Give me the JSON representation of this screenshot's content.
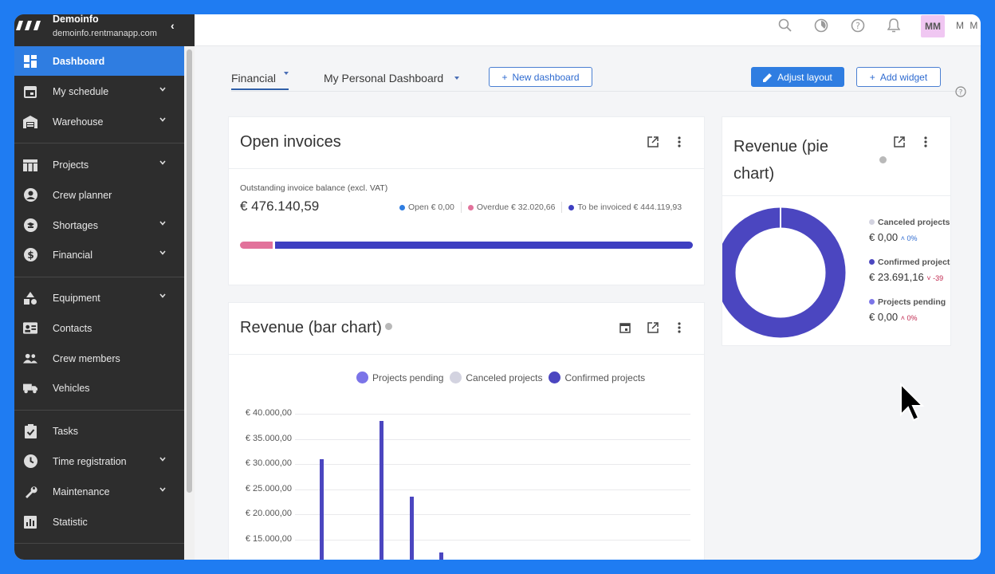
{
  "sidebar": {
    "company": "Demoinfo",
    "url": "demoinfo.rentmanapp.com",
    "items": [
      {
        "label": "Dashboard",
        "icon": "dashboard-icon"
      },
      {
        "label": "My schedule",
        "icon": "calendar-icon"
      },
      {
        "label": "Warehouse",
        "icon": "warehouse-icon"
      },
      {
        "label": "Projects",
        "icon": "projects-icon"
      },
      {
        "label": "Crew planner",
        "icon": "person-icon"
      },
      {
        "label": "Shortages",
        "icon": "shortages-icon"
      },
      {
        "label": "Financial",
        "icon": "dollar-icon"
      },
      {
        "label": "Equipment",
        "icon": "shapes-icon"
      },
      {
        "label": "Contacts",
        "icon": "contact-card-icon"
      },
      {
        "label": "Crew members",
        "icon": "group-icon"
      },
      {
        "label": "Vehicles",
        "icon": "truck-icon"
      },
      {
        "label": "Tasks",
        "icon": "clipboard-check-icon"
      },
      {
        "label": "Time registration",
        "icon": "clock-icon"
      },
      {
        "label": "Maintenance",
        "icon": "wrench-icon"
      },
      {
        "label": "Statistic",
        "icon": "bar-chart-icon"
      }
    ]
  },
  "topbar": {
    "avatar_initials": "MM",
    "username": "M M"
  },
  "tabs": {
    "financial": "Financial",
    "personal": "My Personal Dashboard",
    "new_dashboard": "New dashboard",
    "adjust_layout": "Adjust layout",
    "add_widget": "Add widget"
  },
  "open_invoices": {
    "title": "Open invoices",
    "subtitle": "Outstanding invoice balance (excl. VAT)",
    "total": "€ 476.140,59",
    "legend": [
      {
        "label": "Open",
        "value": "€ 0,00",
        "color": "#2f7de1"
      },
      {
        "label": "Overdue",
        "value": "€ 32.020,66",
        "color": "#e2729b"
      },
      {
        "label": "To be invoiced",
        "value": "€ 444.119,93",
        "color": "#3e3fc1"
      }
    ],
    "progress": {
      "overdue_fraction": 0.073,
      "to_be_invoiced_fraction": 0.927
    }
  },
  "revenue_pie": {
    "title_line1": "Revenue (pie",
    "title_line2": "chart)",
    "legend": [
      {
        "label": "Canceled projects",
        "value": "€ 0,00",
        "change": "0%",
        "color": "#d3d3e0"
      },
      {
        "label": "Confirmed projects",
        "value": "€ 23.691,16",
        "change": "-39",
        "color": "#4b46c0"
      },
      {
        "label": "Projects pending",
        "value": "€ 0,00",
        "change": "0%",
        "color": "#7b74e8"
      }
    ]
  },
  "revenue_bar": {
    "title": "Revenue (bar chart)",
    "legend": [
      {
        "label": "Projects pending",
        "color": "#7b74e8"
      },
      {
        "label": "Canceled projects",
        "color": "#d3d3e0"
      },
      {
        "label": "Confirmed projects",
        "color": "#4b46c0"
      }
    ]
  },
  "chart_data": [
    {
      "type": "pie",
      "title": "Revenue (pie chart)",
      "labels": [
        "Canceled projects",
        "Confirmed projects",
        "Projects pending"
      ],
      "values": [
        0,
        23691.16,
        0
      ]
    },
    {
      "type": "bar",
      "title": "Revenue (bar chart)",
      "series": [
        {
          "name": "Confirmed projects",
          "values": [
            31000,
            38500,
            23500,
            12500
          ]
        }
      ],
      "yticks": [
        "€ 40.000,00",
        "€ 35.000,00",
        "€ 30.000,00",
        "€ 25.000,00",
        "€ 20.000,00",
        "€ 15.000,00"
      ],
      "ylim": [
        15000,
        40000
      ],
      "legend": [
        "Projects pending",
        "Canceled projects",
        "Confirmed projects"
      ]
    }
  ]
}
